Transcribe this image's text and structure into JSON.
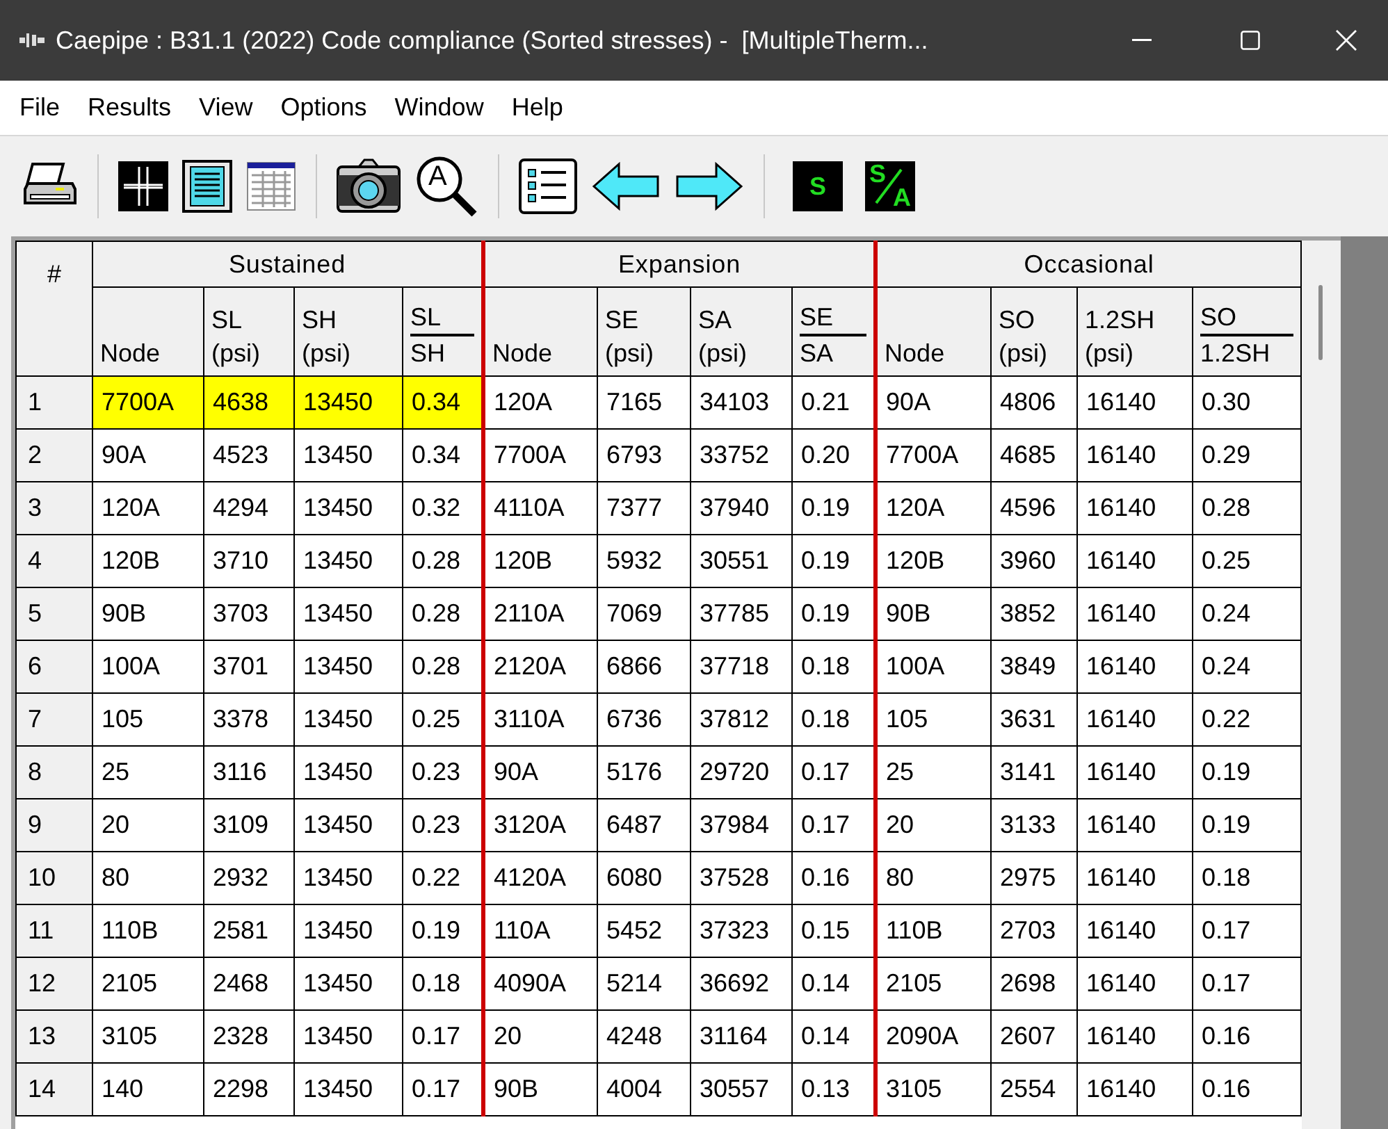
{
  "window": {
    "title": "Caepipe : B31.1 (2022) Code compliance (Sorted stresses) -  [MultipleTherm..."
  },
  "menu": [
    "File",
    "Results",
    "View",
    "Options",
    "Window",
    "Help"
  ],
  "toolbar": [
    {
      "kind": "printer"
    },
    {
      "kind": "sep"
    },
    {
      "kind": "grid"
    },
    {
      "kind": "document"
    },
    {
      "kind": "table"
    },
    {
      "kind": "sep"
    },
    {
      "kind": "camera"
    },
    {
      "kind": "zoom",
      "label": "A"
    },
    {
      "kind": "sep"
    },
    {
      "kind": "list"
    },
    {
      "kind": "left"
    },
    {
      "kind": "right"
    },
    {
      "kind": "sep"
    },
    {
      "kind": "letter",
      "label": "S"
    },
    {
      "kind": "fraction",
      "top": "S",
      "bottom": "A"
    }
  ],
  "table": {
    "number_header": "#",
    "groups": [
      {
        "title": "Sustained",
        "columns": [
          {
            "kind": "plain",
            "label": "Node"
          },
          {
            "kind": "stacked",
            "top": "SL",
            "bottom": "(psi)"
          },
          {
            "kind": "stacked",
            "top": "SH",
            "bottom": "(psi)"
          },
          {
            "kind": "ratio",
            "top": "SL",
            "bottom": "SH"
          }
        ]
      },
      {
        "title": "Expansion",
        "columns": [
          {
            "kind": "plain",
            "label": "Node"
          },
          {
            "kind": "stacked",
            "top": "SE",
            "bottom": "(psi)"
          },
          {
            "kind": "stacked",
            "top": "SA",
            "bottom": "(psi)"
          },
          {
            "kind": "ratio",
            "top": "SE",
            "bottom": "SA"
          }
        ]
      },
      {
        "title": "Occasional",
        "columns": [
          {
            "kind": "plain",
            "label": "Node"
          },
          {
            "kind": "stacked",
            "top": "SO",
            "bottom": "(psi)"
          },
          {
            "kind": "stacked",
            "top": "1.2SH",
            "bottom": "(psi)"
          },
          {
            "kind": "ratio",
            "top": "SO",
            "bottom": "1.2SH"
          }
        ]
      }
    ],
    "rows": [
      {
        "number": "1",
        "groups": [
          {
            "highlighted": true,
            "cells": [
              "7700A",
              "4638",
              "13450",
              "0.34"
            ]
          },
          {
            "highlighted": false,
            "cells": [
              "120A",
              "7165",
              "34103",
              "0.21"
            ]
          },
          {
            "highlighted": false,
            "cells": [
              "90A",
              "4806",
              "16140",
              "0.30"
            ]
          }
        ]
      },
      {
        "number": "2",
        "groups": [
          {
            "highlighted": false,
            "cells": [
              "90A",
              "4523",
              "13450",
              "0.34"
            ]
          },
          {
            "highlighted": false,
            "cells": [
              "7700A",
              "6793",
              "33752",
              "0.20"
            ]
          },
          {
            "highlighted": false,
            "cells": [
              "7700A",
              "4685",
              "16140",
              "0.29"
            ]
          }
        ]
      },
      {
        "number": "3",
        "groups": [
          {
            "highlighted": false,
            "cells": [
              "120A",
              "4294",
              "13450",
              "0.32"
            ]
          },
          {
            "highlighted": false,
            "cells": [
              "4110A",
              "7377",
              "37940",
              "0.19"
            ]
          },
          {
            "highlighted": false,
            "cells": [
              "120A",
              "4596",
              "16140",
              "0.28"
            ]
          }
        ]
      },
      {
        "number": "4",
        "groups": [
          {
            "highlighted": false,
            "cells": [
              "120B",
              "3710",
              "13450",
              "0.28"
            ]
          },
          {
            "highlighted": false,
            "cells": [
              "120B",
              "5932",
              "30551",
              "0.19"
            ]
          },
          {
            "highlighted": false,
            "cells": [
              "120B",
              "3960",
              "16140",
              "0.25"
            ]
          }
        ]
      },
      {
        "number": "5",
        "groups": [
          {
            "highlighted": false,
            "cells": [
              "90B",
              "3703",
              "13450",
              "0.28"
            ]
          },
          {
            "highlighted": false,
            "cells": [
              "2110A",
              "7069",
              "37785",
              "0.19"
            ]
          },
          {
            "highlighted": false,
            "cells": [
              "90B",
              "3852",
              "16140",
              "0.24"
            ]
          }
        ]
      },
      {
        "number": "6",
        "groups": [
          {
            "highlighted": false,
            "cells": [
              "100A",
              "3701",
              "13450",
              "0.28"
            ]
          },
          {
            "highlighted": false,
            "cells": [
              "2120A",
              "6866",
              "37718",
              "0.18"
            ]
          },
          {
            "highlighted": false,
            "cells": [
              "100A",
              "3849",
              "16140",
              "0.24"
            ]
          }
        ]
      },
      {
        "number": "7",
        "groups": [
          {
            "highlighted": false,
            "cells": [
              "105",
              "3378",
              "13450",
              "0.25"
            ]
          },
          {
            "highlighted": false,
            "cells": [
              "3110A",
              "6736",
              "37812",
              "0.18"
            ]
          },
          {
            "highlighted": false,
            "cells": [
              "105",
              "3631",
              "16140",
              "0.22"
            ]
          }
        ]
      },
      {
        "number": "8",
        "groups": [
          {
            "highlighted": false,
            "cells": [
              "25",
              "3116",
              "13450",
              "0.23"
            ]
          },
          {
            "highlighted": false,
            "cells": [
              "90A",
              "5176",
              "29720",
              "0.17"
            ]
          },
          {
            "highlighted": false,
            "cells": [
              "25",
              "3141",
              "16140",
              "0.19"
            ]
          }
        ]
      },
      {
        "number": "9",
        "groups": [
          {
            "highlighted": false,
            "cells": [
              "20",
              "3109",
              "13450",
              "0.23"
            ]
          },
          {
            "highlighted": false,
            "cells": [
              "3120A",
              "6487",
              "37984",
              "0.17"
            ]
          },
          {
            "highlighted": false,
            "cells": [
              "20",
              "3133",
              "16140",
              "0.19"
            ]
          }
        ]
      },
      {
        "number": "10",
        "groups": [
          {
            "highlighted": false,
            "cells": [
              "80",
              "2932",
              "13450",
              "0.22"
            ]
          },
          {
            "highlighted": false,
            "cells": [
              "4120A",
              "6080",
              "37528",
              "0.16"
            ]
          },
          {
            "highlighted": false,
            "cells": [
              "80",
              "2975",
              "16140",
              "0.18"
            ]
          }
        ]
      },
      {
        "number": "11",
        "groups": [
          {
            "highlighted": false,
            "cells": [
              "110B",
              "2581",
              "13450",
              "0.19"
            ]
          },
          {
            "highlighted": false,
            "cells": [
              "110A",
              "5452",
              "37323",
              "0.15"
            ]
          },
          {
            "highlighted": false,
            "cells": [
              "110B",
              "2703",
              "16140",
              "0.17"
            ]
          }
        ]
      },
      {
        "number": "12",
        "groups": [
          {
            "highlighted": false,
            "cells": [
              "2105",
              "2468",
              "13450",
              "0.18"
            ]
          },
          {
            "highlighted": false,
            "cells": [
              "4090A",
              "5214",
              "36692",
              "0.14"
            ]
          },
          {
            "highlighted": false,
            "cells": [
              "2105",
              "2698",
              "16140",
              "0.17"
            ]
          }
        ]
      },
      {
        "number": "13",
        "groups": [
          {
            "highlighted": false,
            "cells": [
              "3105",
              "2328",
              "13450",
              "0.17"
            ]
          },
          {
            "highlighted": false,
            "cells": [
              "20",
              "4248",
              "31164",
              "0.14"
            ]
          },
          {
            "highlighted": false,
            "cells": [
              "2090A",
              "2607",
              "16140",
              "0.16"
            ]
          }
        ]
      },
      {
        "number": "14",
        "groups": [
          {
            "highlighted": false,
            "cells": [
              "140",
              "2298",
              "13450",
              "0.17"
            ]
          },
          {
            "highlighted": false,
            "cells": [
              "90B",
              "4004",
              "30557",
              "0.13"
            ]
          },
          {
            "highlighted": false,
            "cells": [
              "3105",
              "2554",
              "16140",
              "0.16"
            ]
          }
        ]
      }
    ]
  }
}
